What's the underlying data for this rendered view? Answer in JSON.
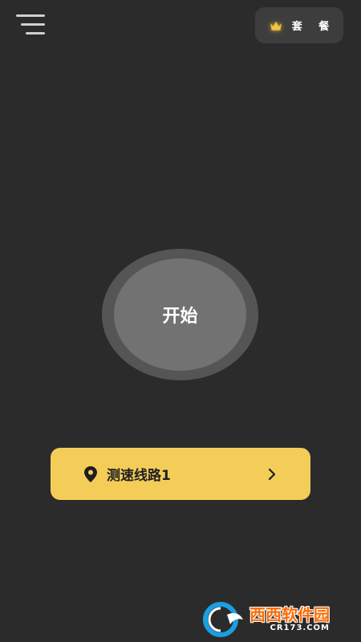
{
  "header": {
    "menu_icon": "hamburger-menu-icon",
    "plan_button": {
      "icon": "crown-icon",
      "label": "套 餐",
      "icon_color": "#f5c542"
    }
  },
  "main": {
    "start_button": {
      "label": "开始",
      "outer_color": "#555555",
      "inner_color": "#727272"
    },
    "route_selector": {
      "icon": "location-pin-icon",
      "label": "测速线路1",
      "trailing_icon": "chevron-right-icon",
      "background": "#f3cd58"
    }
  },
  "watermark": {
    "title": "西西软件园",
    "subtitle": "CR173.COM"
  },
  "colors": {
    "background": "#2b2b2b",
    "accent": "#f3cd58"
  }
}
